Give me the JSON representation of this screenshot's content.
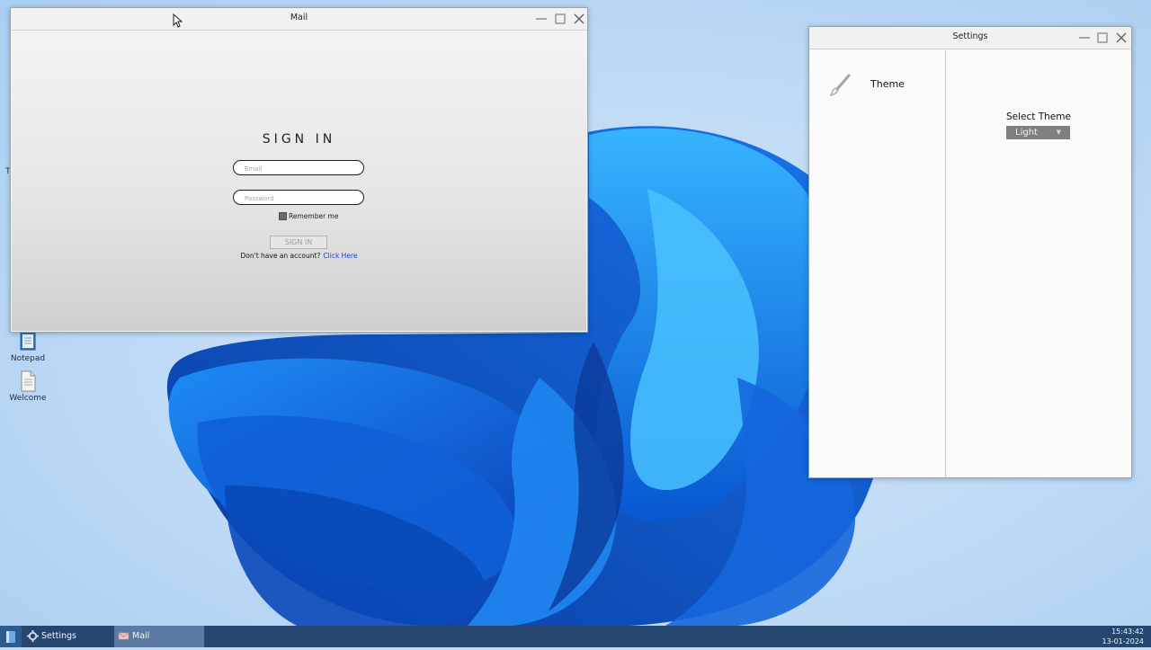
{
  "desktop": {
    "stub_label": "T",
    "icons": [
      {
        "label": "Notepad",
        "icon": "notepad-icon"
      },
      {
        "label": "Welcome",
        "icon": "document-icon"
      }
    ]
  },
  "mail_window": {
    "title": "Mail",
    "heading": "SIGN IN",
    "email_placeholder": "Email",
    "password_placeholder": "Password",
    "remember_label": "Remember me",
    "signin_button": "SIGN IN",
    "account_prompt": "Don't have an account?",
    "account_link": "Click Here"
  },
  "settings_window": {
    "title": "Settings",
    "sidebar_items": [
      {
        "label": "Theme",
        "icon": "paintbrush-icon"
      }
    ],
    "select_label": "Select Theme",
    "theme_value": "Light"
  },
  "taskbar": {
    "items": [
      {
        "label": "Settings",
        "icon": "gear-icon",
        "active": false
      },
      {
        "label": "Mail",
        "icon": "mail-icon",
        "active": true
      }
    ],
    "time": "15:43:42",
    "date": "13-01-2024"
  },
  "colors": {
    "wallpaper_blue": "#1a6fe0",
    "taskbar": "#25476f",
    "link": "#1b3ec9"
  }
}
